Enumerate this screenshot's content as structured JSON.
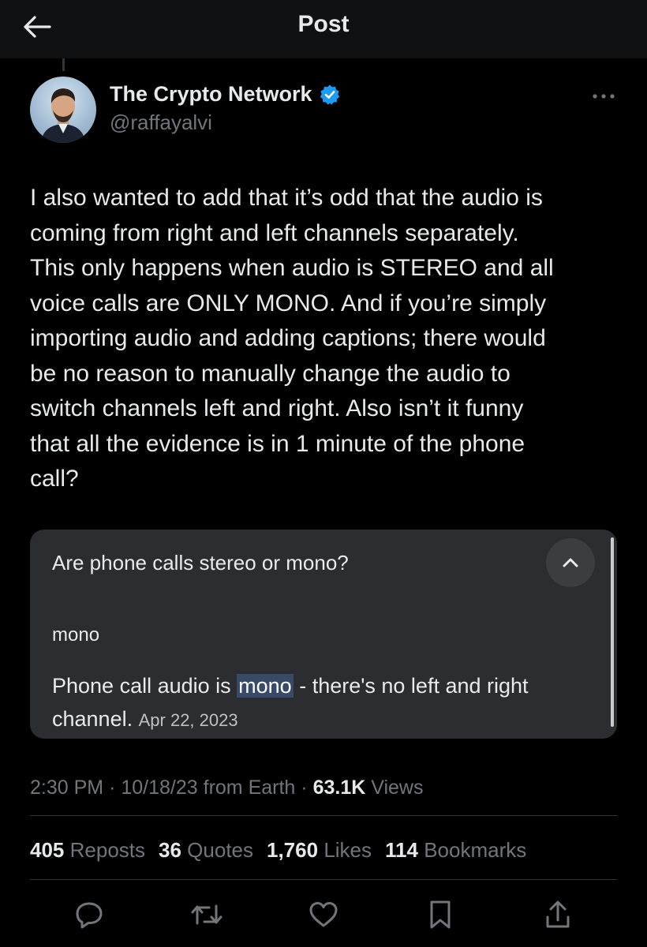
{
  "header": {
    "title": "Post",
    "back_icon": "arrow-left-icon"
  },
  "author": {
    "display_name": "The Crypto Network",
    "handle": "@raffayalvi",
    "verified": true,
    "verified_color": "#1d9bf0"
  },
  "tweet": {
    "text": "I also wanted to add that it’s odd that the audio is\ncoming from right and left channels separately.\nThis only happens when audio is STEREO and all\nvoice calls are ONLY MONO. And if you’re simply\nimporting audio and adding captions; there would\nbe no reason to manually change the audio to\nswitch channels left and right. Also isn’t it funny\nthat all the evidence is in 1 minute of the phone\ncall?"
  },
  "card": {
    "question": "Are phone calls stereo or mono?",
    "answer": "mono",
    "snippet_before": "Phone call audio is ",
    "snippet_highlight": "mono",
    "snippet_after": " - there's no left and right channel.",
    "date": "Apr 22, 2023",
    "highlight_color": "#394a67"
  },
  "meta": {
    "time": "2:30 PM",
    "date": "10/18/23",
    "source": "from Earth",
    "sep": "·",
    "views_count": "63.1K",
    "views_label": "Views"
  },
  "stats": [
    {
      "count": "405",
      "label": "Reposts"
    },
    {
      "count": "36",
      "label": "Quotes"
    },
    {
      "count": "1,760",
      "label": "Likes"
    },
    {
      "count": "114",
      "label": "Bookmarks"
    }
  ],
  "actions": [
    "reply-icon",
    "repost-icon",
    "like-icon",
    "bookmark-icon",
    "share-icon"
  ],
  "colors": {
    "background": "#000000",
    "text": "#e7e9ea",
    "muted": "#71767b",
    "card_bg": "#2c2d30"
  }
}
